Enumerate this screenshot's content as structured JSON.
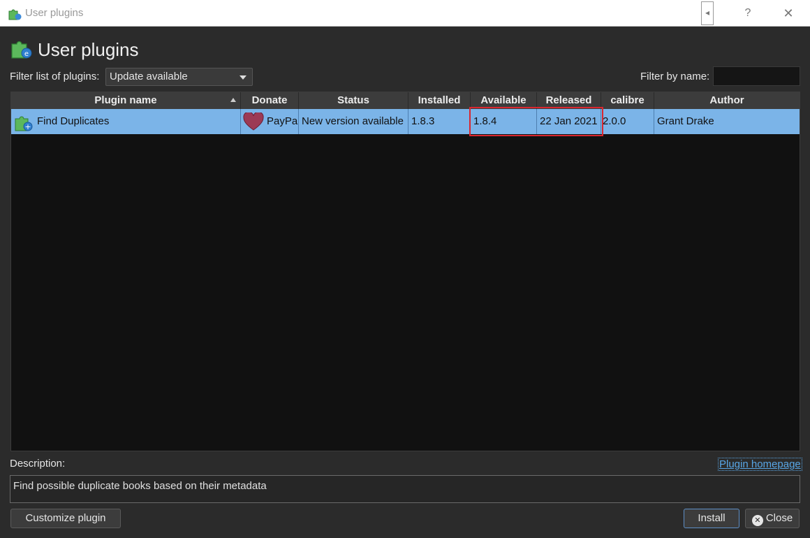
{
  "window": {
    "title": "User plugins",
    "controls": {
      "help": "?",
      "close": "✕"
    }
  },
  "heading": "User plugins",
  "filters": {
    "list_label": "Filter list of plugins:",
    "list_value": "Update available",
    "name_label": "Filter by name:",
    "name_value": ""
  },
  "table": {
    "columns": [
      "Plugin name",
      "Donate",
      "Status",
      "Installed",
      "Available",
      "Released",
      "calibre",
      "Author"
    ],
    "rows": [
      {
        "plugin_name": "Find Duplicates",
        "donate": "PayPal",
        "status": "New version available",
        "installed": "1.8.3",
        "available": "1.8.4",
        "released": "22 Jan 2021",
        "calibre": "2.0.0",
        "author": "Grant Drake"
      }
    ]
  },
  "description": {
    "label": "Description:",
    "text": "Find possible duplicate books based on their metadata",
    "homepage_link": "Plugin homepage"
  },
  "buttons": {
    "customize": "Customize plugin",
    "install": "Install",
    "close": "Close"
  },
  "colors": {
    "selection": "#7bb4e8",
    "highlight_box": "#d9262f",
    "link": "#58a6e6"
  }
}
